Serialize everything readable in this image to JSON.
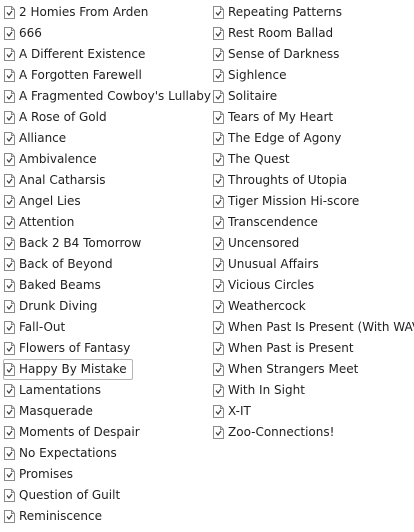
{
  "file_list": {
    "left_column": [
      {
        "label": "2 Homies From Arden",
        "icon": "audio-file-icon"
      },
      {
        "label": "666",
        "icon": "audio-file-icon"
      },
      {
        "label": "A Different Existence",
        "icon": "audio-file-icon"
      },
      {
        "label": "A Forgotten Farewell",
        "icon": "audio-file-icon"
      },
      {
        "label": "A Fragmented Cowboy's Lullaby",
        "icon": "audio-file-icon"
      },
      {
        "label": "A Rose of Gold",
        "icon": "audio-file-icon"
      },
      {
        "label": "Alliance",
        "icon": "audio-file-icon"
      },
      {
        "label": "Ambivalence",
        "icon": "audio-file-icon"
      },
      {
        "label": "Anal Catharsis",
        "icon": "audio-file-icon"
      },
      {
        "label": "Angel Lies",
        "icon": "audio-file-icon"
      },
      {
        "label": "Attention",
        "icon": "audio-file-icon"
      },
      {
        "label": "Back 2 B4 Tomorrow",
        "icon": "audio-file-icon"
      },
      {
        "label": "Back of Beyond",
        "icon": "audio-file-icon"
      },
      {
        "label": "Baked Beams",
        "icon": "audio-file-icon"
      },
      {
        "label": "Drunk Diving",
        "icon": "audio-file-icon"
      },
      {
        "label": "Fall-Out",
        "icon": "audio-file-icon"
      },
      {
        "label": "Flowers of Fantasy",
        "icon": "audio-file-icon"
      },
      {
        "label": "Happy By Mistake",
        "icon": "audio-file-icon",
        "selected": true
      },
      {
        "label": "Lamentations",
        "icon": "audio-file-icon"
      },
      {
        "label": "Masquerade",
        "icon": "audio-file-icon"
      },
      {
        "label": "Moments of Despair",
        "icon": "audio-file-icon"
      },
      {
        "label": "No Expectations",
        "icon": "audio-file-icon"
      },
      {
        "label": "Promises",
        "icon": "audio-file-icon"
      },
      {
        "label": "Question of Guilt",
        "icon": "audio-file-icon"
      },
      {
        "label": "Reminiscence",
        "icon": "audio-file-icon"
      }
    ],
    "right_column": [
      {
        "label": "Repeating Patterns",
        "icon": "audio-file-icon"
      },
      {
        "label": "Rest Room Ballad",
        "icon": "audio-file-icon"
      },
      {
        "label": "Sense of Darkness",
        "icon": "audio-file-icon"
      },
      {
        "label": "Sighlence",
        "icon": "audio-file-icon"
      },
      {
        "label": "Solitaire",
        "icon": "audio-file-icon"
      },
      {
        "label": "Tears of My Heart",
        "icon": "audio-file-icon"
      },
      {
        "label": "The Edge of Agony",
        "icon": "audio-file-icon"
      },
      {
        "label": "The Quest",
        "icon": "audio-file-icon"
      },
      {
        "label": "Throughts of Utopia",
        "icon": "audio-file-icon"
      },
      {
        "label": "Tiger Mission Hi-score",
        "icon": "audio-file-icon"
      },
      {
        "label": "Transcendence",
        "icon": "audio-file-icon"
      },
      {
        "label": "Uncensored",
        "icon": "audio-file-icon"
      },
      {
        "label": "Unusual Affairs",
        "icon": "audio-file-icon"
      },
      {
        "label": "Vicious Circles",
        "icon": "audio-file-icon"
      },
      {
        "label": "Weathercock",
        "icon": "audio-file-icon"
      },
      {
        "label": "When Past Is Present (With WAVE)",
        "icon": "audio-file-icon"
      },
      {
        "label": "When Past is Present",
        "icon": "audio-file-icon"
      },
      {
        "label": "When Strangers Meet",
        "icon": "audio-file-icon"
      },
      {
        "label": "With In Sight",
        "icon": "audio-file-icon"
      },
      {
        "label": "X-IT",
        "icon": "audio-file-icon"
      },
      {
        "label": "Zoo-Connections!",
        "icon": "audio-file-icon"
      }
    ]
  },
  "colors": {
    "text": "#1f1f1f",
    "selection_border": "#b5b5b5",
    "icon_outline": "#8a8a8a",
    "icon_glyph": "#3a3a3a"
  }
}
